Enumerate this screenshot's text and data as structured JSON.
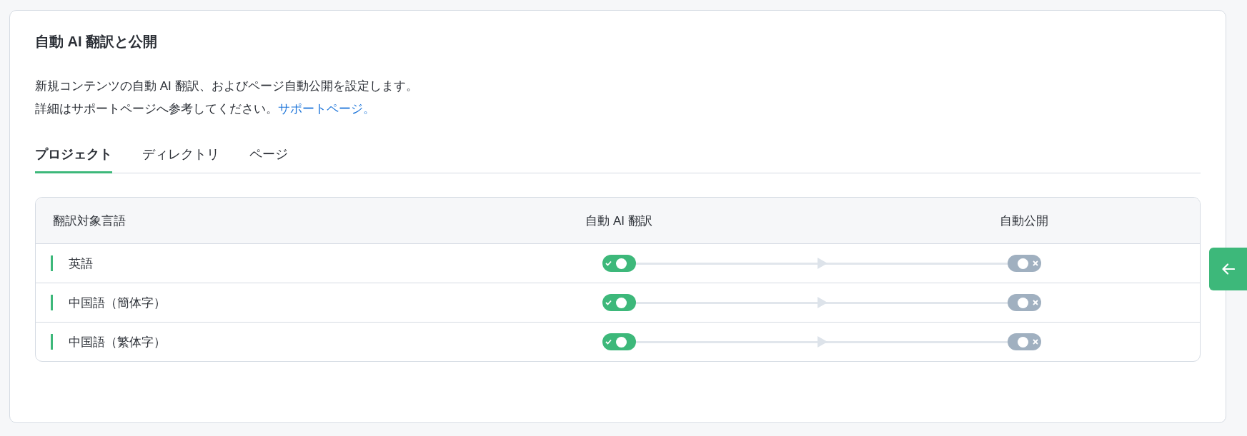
{
  "section": {
    "title": "自動 AI 翻訳と公開",
    "description": "新規コンテンツの自動 AI 翻訳、およびページ自動公開を設定します。",
    "help_text": "詳細はサポートページへ参考してください。",
    "help_link": "サポートページ。"
  },
  "tabs": [
    {
      "label": "プロジェクト",
      "selected": true
    },
    {
      "label": "ディレクトリ",
      "selected": false
    },
    {
      "label": "ページ",
      "selected": false
    }
  ],
  "table": {
    "columns": [
      "翻訳対象言語",
      "自動 AI 翻訳",
      "自動公開"
    ],
    "rows": [
      {
        "language": "英語",
        "auto_ai_translate": true,
        "auto_publish": false
      },
      {
        "language": "中国語（簡体字）",
        "auto_ai_translate": true,
        "auto_publish": false
      },
      {
        "language": "中国語（繁体字）",
        "auto_ai_translate": true,
        "auto_publish": false
      }
    ]
  }
}
